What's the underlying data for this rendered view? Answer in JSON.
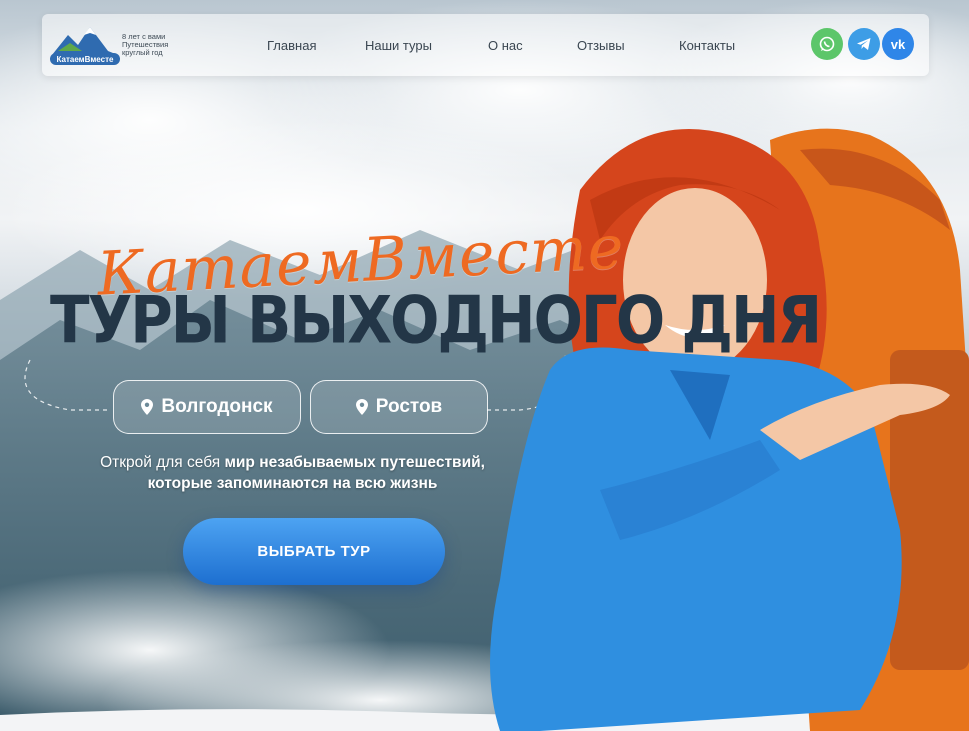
{
  "brand": {
    "logo_text": "КатаемВместе",
    "tagline": "8 лет с вами\nПутешествия\nкруглый год"
  },
  "nav": {
    "items": [
      "Главная",
      "Наши туры",
      "О нас",
      "Отзывы",
      "Контакты"
    ]
  },
  "social": {
    "whatsapp": "whatsapp-icon",
    "telegram": "telegram-icon",
    "vk": "vk-icon",
    "vk_text": "vk"
  },
  "hero": {
    "script_title": "КатаемВместе",
    "headline": "ТУРЫ ВЫХОДНОГО ДНЯ",
    "cities": [
      "Волгодонск",
      "Ростов"
    ],
    "subtitle_plain": "Открой для себя",
    "subtitle_bold": "мир незабываемых путешествий, которые запоминаются на всю жизнь",
    "cta_label": "ВЫБРАТЬ ТУР"
  },
  "colors": {
    "accent_orange": "#ee6a22",
    "cta_blue": "#1d6fd0",
    "whatsapp": "#5cc66a",
    "telegram": "#3d9de6",
    "vk": "#2f86e8",
    "headline": "#233647"
  }
}
